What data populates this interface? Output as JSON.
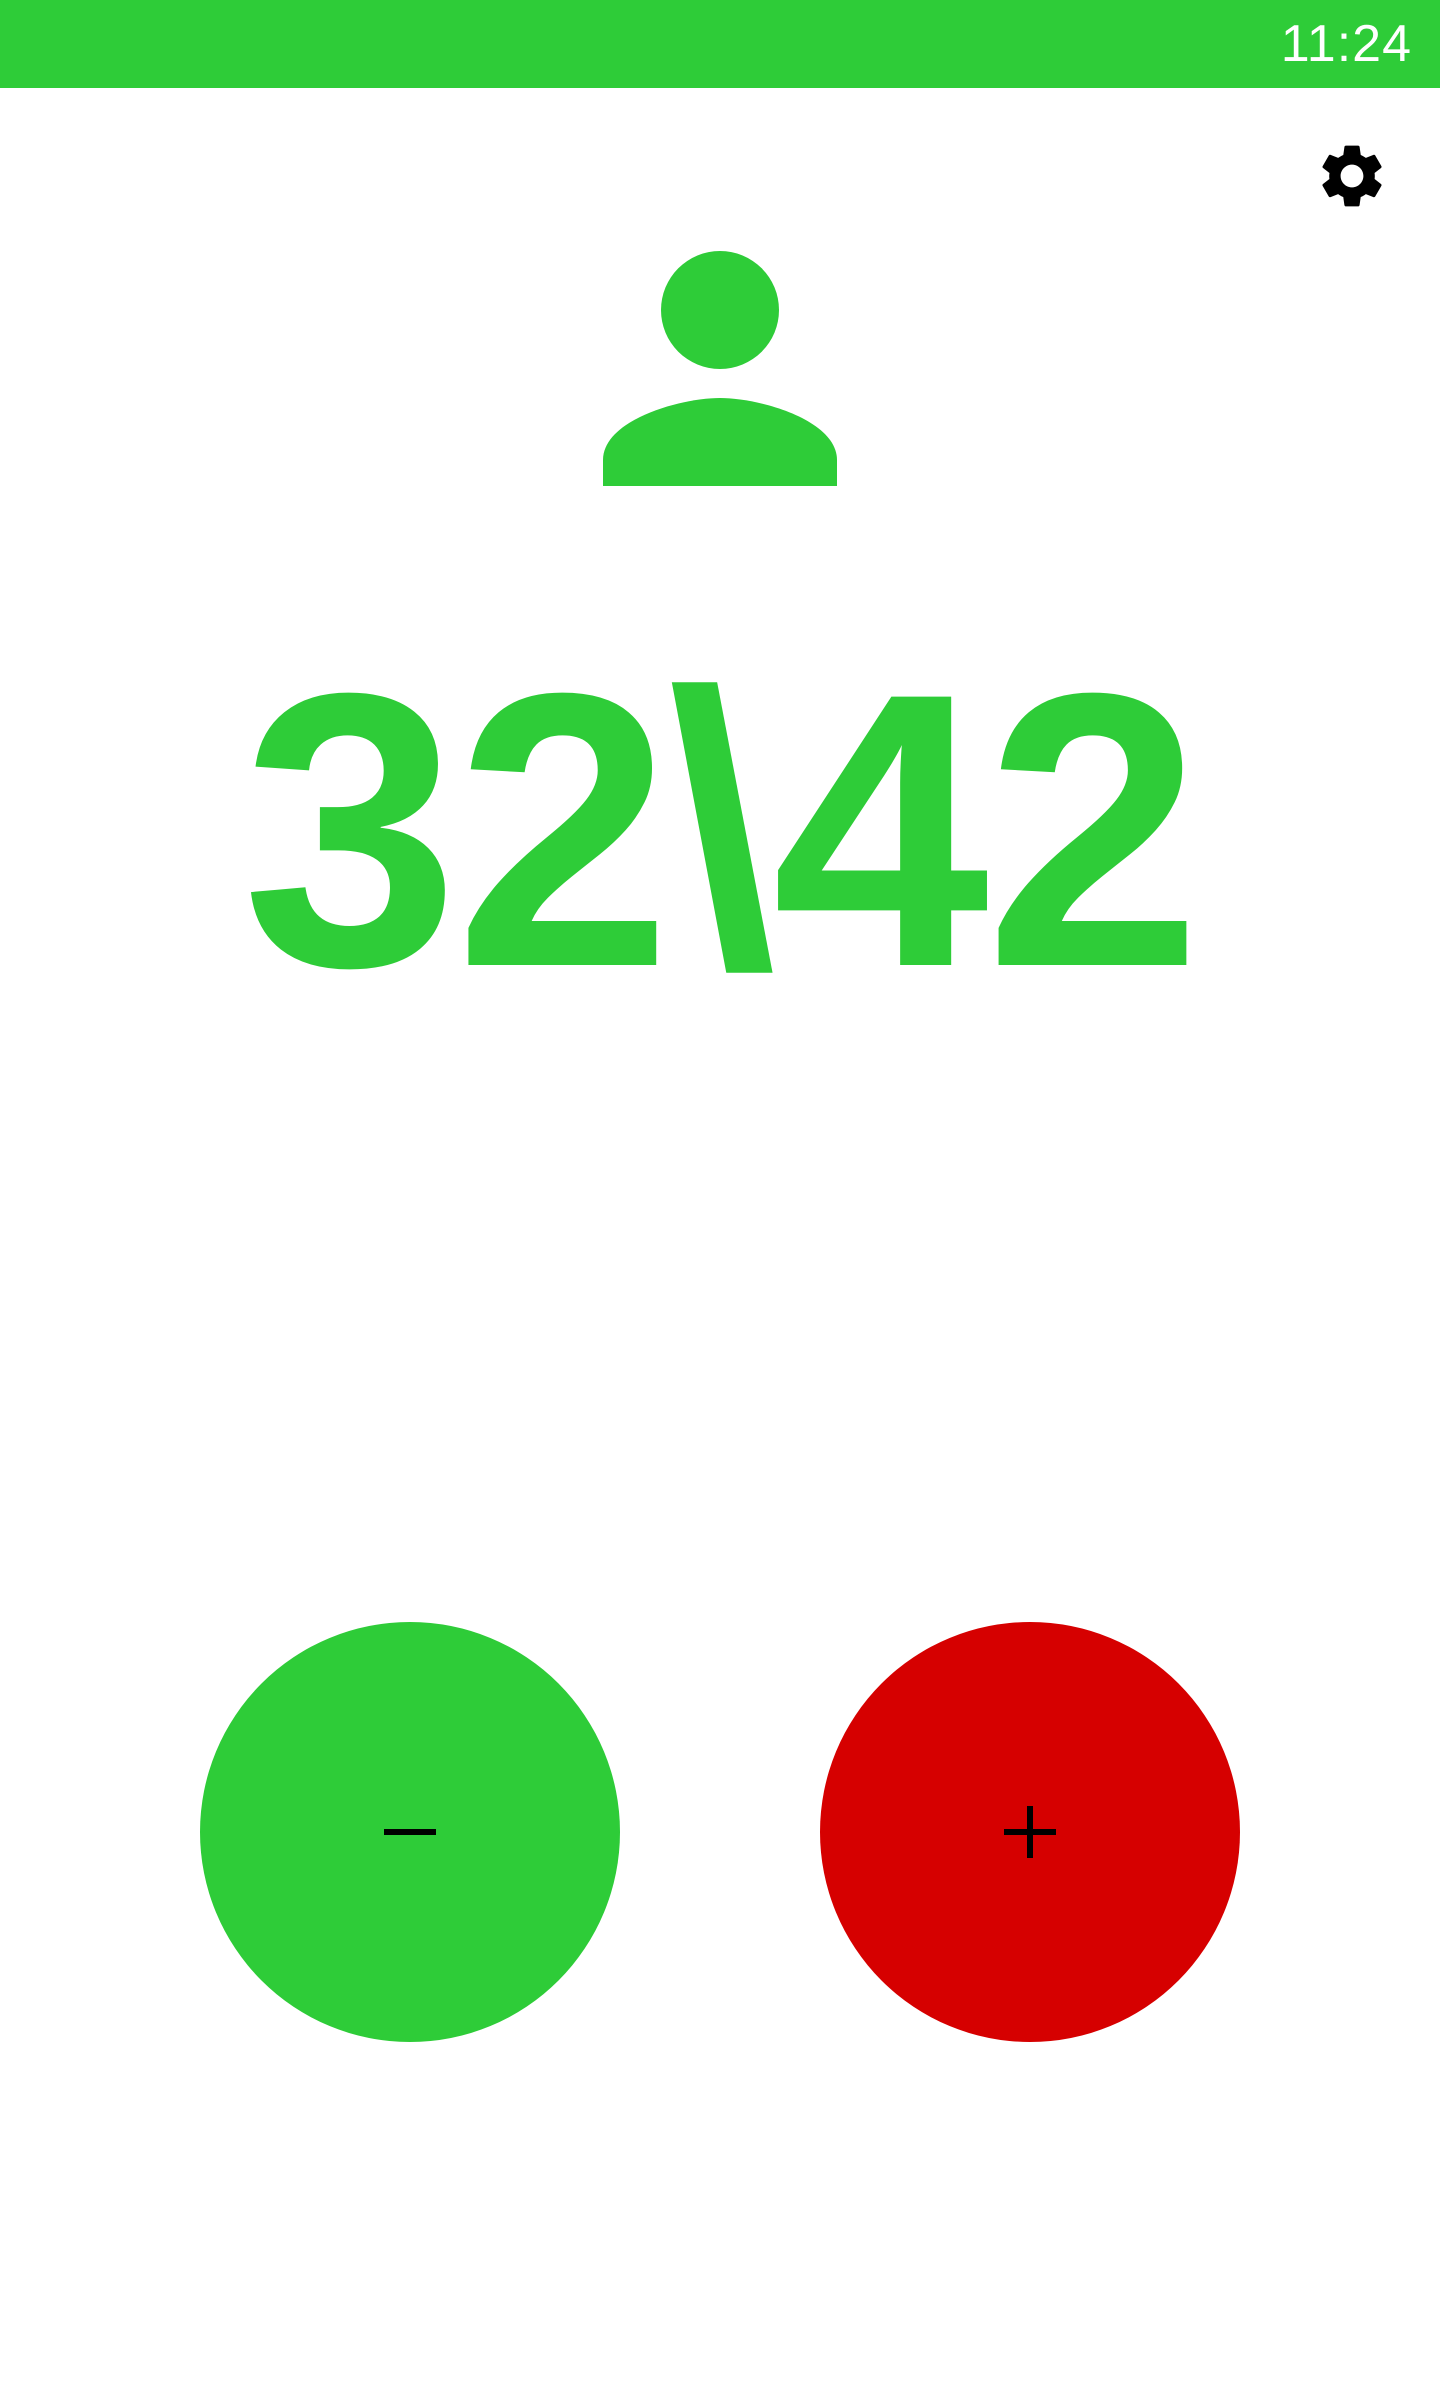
{
  "status_bar": {
    "time": "11:24",
    "background_color": "#2ecc38"
  },
  "toolbar": {
    "settings_icon": "gear-icon"
  },
  "player": {
    "icon": "person-icon",
    "color": "#2ecc38"
  },
  "counter": {
    "text": "32\\42",
    "current": 32,
    "total": 42,
    "color": "#2ecc38"
  },
  "controls": {
    "minus": {
      "icon": "minus-icon",
      "color": "#2ecc38"
    },
    "plus": {
      "icon": "plus-icon",
      "color": "#d60000"
    }
  }
}
